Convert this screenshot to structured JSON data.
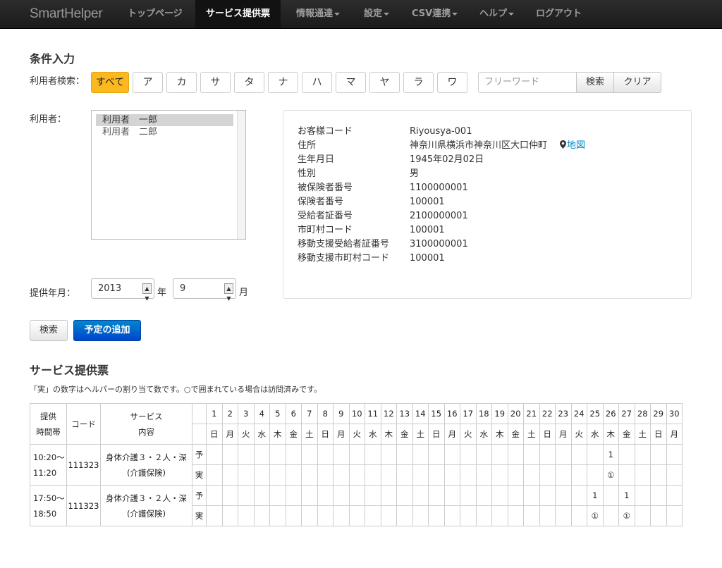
{
  "nav": {
    "brand": "SmartHelper",
    "items": [
      {
        "label": "トップページ"
      },
      {
        "label": "サービス提供票"
      },
      {
        "label": "情報通達"
      },
      {
        "label": "設定"
      },
      {
        "label": "CSV連携"
      },
      {
        "label": "ヘルプ"
      },
      {
        "label": "ログアウト"
      }
    ]
  },
  "conditions": {
    "title": "条件入力",
    "user_search_label": "利用者検索：",
    "kana_buttons": [
      "すべて",
      "ア",
      "カ",
      "サ",
      "タ",
      "ナ",
      "ハ",
      "マ",
      "ヤ",
      "ラ",
      "ワ"
    ],
    "selected_kana": "すべて",
    "search_placeholder": "フリーワード",
    "search_button": "検索",
    "clear_button": "クリア",
    "user_label": "利用者：",
    "users": [
      "利用者　一郎",
      "利用者　二郎"
    ],
    "selected_user": "利用者　一郎",
    "period_label": "提供年月：",
    "year": "2013",
    "year_unit": "年",
    "month": "9",
    "month_unit": "月",
    "search2_button": "検索",
    "add_schedule_button": "予定の追加"
  },
  "customer": {
    "rows": [
      {
        "key": "お客様コード",
        "value": "Riyousya-001"
      },
      {
        "key": "住所",
        "value": "神奈川県横浜市神奈川区大口仲町"
      },
      {
        "key": "生年月日",
        "value": "1945年02月02日"
      },
      {
        "key": "性別",
        "value": "男"
      },
      {
        "key": "被保険者番号",
        "value": "1100000001"
      },
      {
        "key": "保険者番号",
        "value": "100001"
      },
      {
        "key": "受給者証番号",
        "value": "2100000001"
      },
      {
        "key": "市町村コード",
        "value": "100001"
      },
      {
        "key": "移動支援受給者証番号",
        "value": "3100000001"
      },
      {
        "key": "移動支援市町村コード",
        "value": "100001"
      }
    ],
    "map_link": "地図"
  },
  "service_sheet": {
    "title": "サービス提供票",
    "note": "「実」の数字はヘルパーの割り当て数です。○で囲まれている場合は訪問済みです。",
    "headers": {
      "time": [
        "提供",
        "時間帯"
      ],
      "code": "コード",
      "service": [
        "サービス",
        "内容"
      ]
    },
    "days": [
      "1",
      "2",
      "3",
      "4",
      "5",
      "6",
      "7",
      "8",
      "9",
      "10",
      "11",
      "12",
      "13",
      "14",
      "15",
      "16",
      "17",
      "18",
      "19",
      "20",
      "21",
      "22",
      "23",
      "24",
      "25",
      "26",
      "27",
      "28",
      "29",
      "30"
    ],
    "weekdays": [
      "日",
      "月",
      "火",
      "水",
      "木",
      "金",
      "土",
      "日",
      "月",
      "火",
      "水",
      "木",
      "金",
      "土",
      "日",
      "月",
      "火",
      "水",
      "木",
      "金",
      "土",
      "日",
      "月",
      "火",
      "水",
      "木",
      "金",
      "土",
      "日",
      "月"
    ],
    "plan_label": "予",
    "actual_label": "実",
    "rows": [
      {
        "time_start": "10:20〜",
        "time_end": "11:20",
        "code": "111323",
        "service": "身体介護３・２人・深",
        "service_sub": "(介護保険)",
        "plan": {
          "26": "1"
        },
        "actual": {
          "26": "①"
        }
      },
      {
        "time_start": "17:50〜",
        "time_end": "18:50",
        "code": "111323",
        "service": "身体介護３・２人・深",
        "service_sub": "(介護保険)",
        "plan": {
          "25": "1",
          "27": "1"
        },
        "actual": {
          "25": "①",
          "27": "①"
        }
      }
    ]
  }
}
